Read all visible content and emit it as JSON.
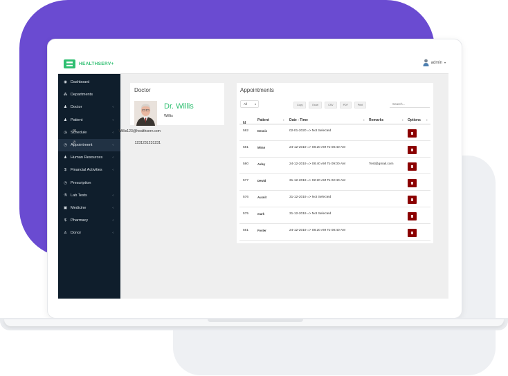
{
  "brand": "HEALTHSERV+",
  "user": {
    "name": "admin"
  },
  "sidebar": {
    "items": [
      {
        "icon": "dashboard-icon",
        "label": "Dashboard",
        "has_submenu": false,
        "active": false
      },
      {
        "icon": "sitemap-icon",
        "label": "Departments",
        "has_submenu": false,
        "active": false
      },
      {
        "icon": "users-icon",
        "label": "Doctor",
        "has_submenu": true,
        "active": false
      },
      {
        "icon": "users-icon",
        "label": "Patient",
        "has_submenu": true,
        "active": false
      },
      {
        "icon": "clock-icon",
        "label": "Schedule",
        "has_submenu": true,
        "active": false
      },
      {
        "icon": "clock-icon",
        "label": "Appointment",
        "has_submenu": true,
        "active": true
      },
      {
        "icon": "users-icon",
        "label": "Human Resources",
        "has_submenu": true,
        "active": false
      },
      {
        "icon": "dollar-icon",
        "label": "Financial Activities",
        "has_submenu": true,
        "active": false
      },
      {
        "icon": "clock-icon",
        "label": "Prescription",
        "has_submenu": false,
        "active": false
      },
      {
        "icon": "flask-icon",
        "label": "Lab Tests",
        "has_submenu": true,
        "active": false
      },
      {
        "icon": "medkit-icon",
        "label": "Medicine",
        "has_submenu": true,
        "active": false
      },
      {
        "icon": "dollar-icon",
        "label": "Pharmacy",
        "has_submenu": true,
        "active": false
      },
      {
        "icon": "user-icon",
        "label": "Donor",
        "has_submenu": true,
        "active": false
      }
    ]
  },
  "doctor": {
    "panel_title": "Doctor",
    "name": "Dr. Willis",
    "subname": "Willis",
    "email": "Willis123@healthserv.com",
    "phone": "1231231231231"
  },
  "appointments": {
    "title": "Appointments",
    "page_size": "All",
    "export_buttons": [
      "Copy",
      "Excel",
      "CSV",
      "PDF",
      "Print"
    ],
    "search_placeholder": "Search...",
    "columns": [
      "Id",
      "Patient",
      "Date - Time",
      "Remarks",
      "Options"
    ],
    "rows": [
      {
        "id": "582",
        "patient": "Dennis",
        "datetime": "02-01-2020 => Not Selected",
        "remarks": ""
      },
      {
        "id": "581",
        "patient": "Miran",
        "datetime": "24-12-2019 => 08:20 AM To 08:40 AM",
        "remarks": ""
      },
      {
        "id": "580",
        "patient": "Axley",
        "datetime": "24-12-2019 => 08:40 AM To 09:00 AM",
        "remarks": "Test@gmail.com"
      },
      {
        "id": "577",
        "patient": "Dewid",
        "datetime": "31-12-2019 => 02:20 AM To 02:40 AM",
        "remarks": ""
      },
      {
        "id": "576",
        "patient": "Auxnit",
        "datetime": "31-12-2019 => Not Selected",
        "remarks": ""
      },
      {
        "id": "575",
        "patient": "mark",
        "datetime": "31-12-2019 => Not Selected",
        "remarks": ""
      },
      {
        "id": "561",
        "patient": "Foster",
        "datetime": "24-12-2019 => 08:20 AM To 08:40 AM",
        "remarks": ""
      }
    ]
  },
  "colors": {
    "accent": "#2fbf71",
    "sidebar_bg": "#0f1e2c",
    "sidebar_active": "#213244",
    "delete_button": "#8b0000",
    "backdrop_purple": "#6a4bd1"
  }
}
